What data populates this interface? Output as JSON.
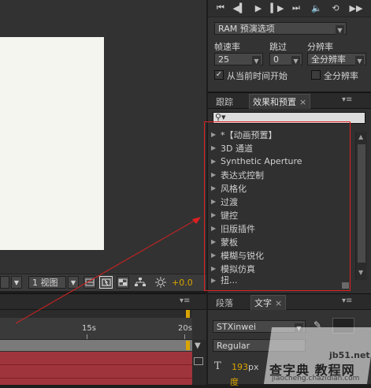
{
  "viewer": {
    "zoom_select": "1 视图",
    "exposure_value": "+0.0"
  },
  "preview": {
    "ram_select": "RAM 预演选项",
    "frame_rate_label": "帧速率",
    "skip_label": "跳过",
    "resolution_label": "分辨率",
    "frame_rate_value": "25",
    "skip_value": "0",
    "resolution_value": "全分辨率",
    "from_current_label": "从当前时间开始",
    "full_screen_label": "全分辨率",
    "from_current_checked": true,
    "full_screen_checked": false
  },
  "effects_panel": {
    "tab_tracker": "跟踪",
    "tab_effects": "效果和预置",
    "search_value": "",
    "items": [
      {
        "label": "*【动画预置】"
      },
      {
        "label": "3D 通道"
      },
      {
        "label": "Synthetic Aperture"
      },
      {
        "label": "表达式控制"
      },
      {
        "label": "风格化"
      },
      {
        "label": "过渡"
      },
      {
        "label": "键控"
      },
      {
        "label": "旧版插件"
      },
      {
        "label": "蒙板"
      },
      {
        "label": "模糊与锐化"
      },
      {
        "label": "模拟仿真"
      },
      {
        "label": "扭..."
      }
    ]
  },
  "timeline": {
    "tick_15s": "15s",
    "tick_20s": "20s"
  },
  "character_panel": {
    "tab_paragraph": "段落",
    "tab_character": "文字",
    "font_family": "STXinwei",
    "font_style": "Regular",
    "font_size_value": "193",
    "font_size_unit": "px",
    "tracking_label": "度"
  },
  "watermark": {
    "site": "jb51.net",
    "brand": "查字典 教程网",
    "url": "jiaocheng.chazidian.com"
  },
  "colors": {
    "annotation_red": "#e02020",
    "accent_orange": "#d9a400"
  }
}
